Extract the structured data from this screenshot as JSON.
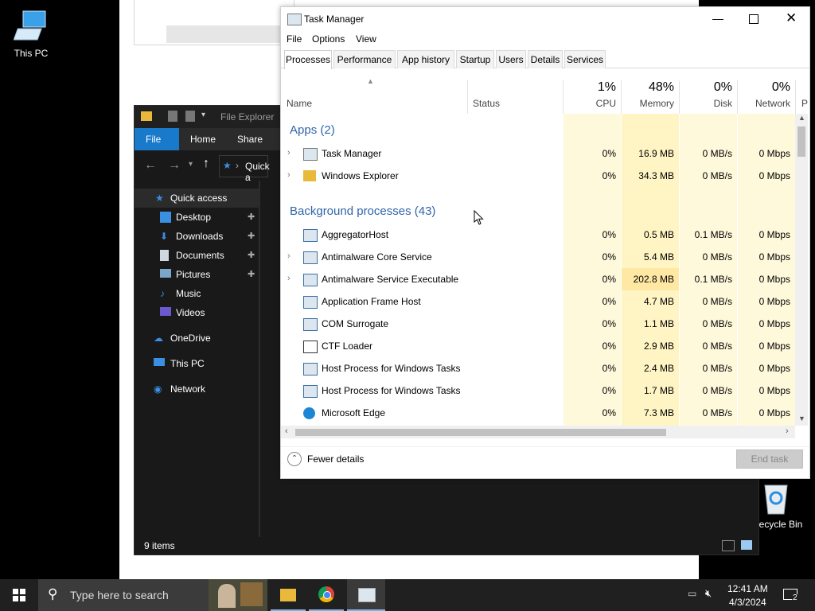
{
  "desktop": {
    "icons": [
      {
        "label": "This PC"
      },
      {
        "label": "ecycle Bin"
      }
    ]
  },
  "explorer": {
    "title": "File Explorer",
    "ribbon": {
      "file": "File",
      "home": "Home",
      "share": "Share"
    },
    "address": "Quick a",
    "nav": [
      {
        "label": "Quick access",
        "icon": "star-icon"
      },
      {
        "label": "Desktop",
        "icon": "desktop-folder-icon",
        "pinned": true
      },
      {
        "label": "Downloads",
        "icon": "download-arrow-icon",
        "pinned": true
      },
      {
        "label": "Documents",
        "icon": "documents-icon",
        "pinned": true
      },
      {
        "label": "Pictures",
        "icon": "pictures-icon",
        "pinned": true
      },
      {
        "label": "Music",
        "icon": "music-note-icon"
      },
      {
        "label": "Videos",
        "icon": "video-icon"
      },
      {
        "label": "OneDrive",
        "icon": "cloud-icon"
      },
      {
        "label": "This PC",
        "icon": "computer-icon"
      },
      {
        "label": "Network",
        "icon": "network-icon"
      }
    ],
    "status": "9 items"
  },
  "task_manager": {
    "title": "Task Manager",
    "menu": [
      "File",
      "Options",
      "View"
    ],
    "tabs": [
      "Processes",
      "Performance",
      "App history",
      "Startup",
      "Users",
      "Details",
      "Services"
    ],
    "columns": {
      "name": "Name",
      "status": "Status",
      "cpu": {
        "pct": "1%",
        "label": "CPU"
      },
      "memory": {
        "pct": "48%",
        "label": "Memory"
      },
      "disk": {
        "pct": "0%",
        "label": "Disk"
      },
      "network": {
        "pct": "0%",
        "label": "Network"
      },
      "power_initial": "P"
    },
    "groups": {
      "apps": "Apps (2)",
      "background": "Background processes (43)"
    },
    "apps": [
      {
        "name": "Task Manager",
        "cpu": "0%",
        "memory": "16.9 MB",
        "disk": "0 MB/s",
        "network": "0 Mbps"
      },
      {
        "name": "Windows Explorer",
        "cpu": "0%",
        "memory": "34.3 MB",
        "disk": "0 MB/s",
        "network": "0 Mbps"
      }
    ],
    "background": [
      {
        "name": "AggregatorHost",
        "cpu": "0%",
        "memory": "0.5 MB",
        "disk": "0.1 MB/s",
        "network": "0 Mbps",
        "expandable": false
      },
      {
        "name": "Antimalware Core Service",
        "cpu": "0%",
        "memory": "5.4 MB",
        "disk": "0 MB/s",
        "network": "0 Mbps",
        "expandable": true
      },
      {
        "name": "Antimalware Service Executable",
        "cpu": "0%",
        "memory": "202.8 MB",
        "disk": "0.1 MB/s",
        "network": "0 Mbps",
        "expandable": true
      },
      {
        "name": "Application Frame Host",
        "cpu": "0%",
        "memory": "4.7 MB",
        "disk": "0 MB/s",
        "network": "0 Mbps",
        "expandable": false
      },
      {
        "name": "COM Surrogate",
        "cpu": "0%",
        "memory": "1.1 MB",
        "disk": "0 MB/s",
        "network": "0 Mbps",
        "expandable": false
      },
      {
        "name": "CTF Loader",
        "cpu": "0%",
        "memory": "2.9 MB",
        "disk": "0 MB/s",
        "network": "0 Mbps",
        "expandable": false
      },
      {
        "name": "Host Process for Windows Tasks",
        "cpu": "0%",
        "memory": "2.4 MB",
        "disk": "0 MB/s",
        "network": "0 Mbps",
        "expandable": false
      },
      {
        "name": "Host Process for Windows Tasks",
        "cpu": "0%",
        "memory": "1.7 MB",
        "disk": "0 MB/s",
        "network": "0 Mbps",
        "expandable": false
      },
      {
        "name": "Microsoft Edge",
        "cpu": "0%",
        "memory": "7.3 MB",
        "disk": "0 MB/s",
        "network": "0 Mbps",
        "expandable": false
      }
    ],
    "footer": {
      "fewer_details": "Fewer details",
      "end_task": "End task"
    }
  },
  "taskbar": {
    "search_placeholder": "Type here to search",
    "time": "12:41 AM",
    "date": "4/3/2024",
    "notification_count": "2"
  },
  "colors": {
    "accent": "#1979ca",
    "heat_light": "#fff9dc",
    "heat_mid": "#fff4c4",
    "heat_strong": "#ffe8a3",
    "group_text": "#2f65a8",
    "taskbar": "#202020"
  }
}
